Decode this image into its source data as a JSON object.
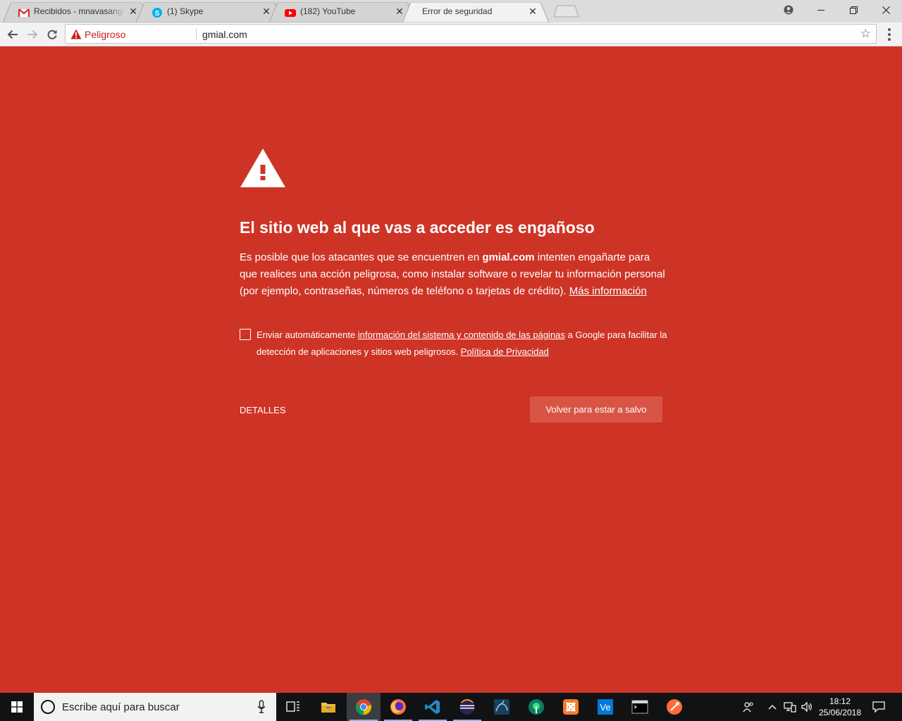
{
  "browser": {
    "tabs": [
      {
        "title": "Recibidos - mnavasangue",
        "favicon": "gmail-icon"
      },
      {
        "title": "(1) Skype",
        "favicon": "skype-icon"
      },
      {
        "title": "(182) YouTube",
        "favicon": "youtube-icon"
      },
      {
        "title": "Error de seguridad",
        "favicon": "none",
        "active": true
      }
    ],
    "omnibox": {
      "security_label": "Peligroso",
      "url": "gmial.com"
    }
  },
  "interstitial": {
    "heading": "El sitio web al que vas a acceder es engañoso",
    "description_pre": "Es posible que los atacantes que se encuentren en ",
    "description_domain": "gmial.com",
    "description_post": " intenten engañarte para que realices una acción peligrosa, como instalar software o revelar tu información personal (por ejemplo, contraseñas, números de teléfono o tarjetas de crédito). ",
    "more_info_link": "Más información",
    "optin_pre": "Enviar automáticamente ",
    "optin_link": "información del sistema y contenido de las páginas",
    "optin_mid": " a Google para facilitar la detección de aplicaciones y sitios web peligrosos. ",
    "privacy_link": "Política de Privacidad",
    "details_button": "DETALLES",
    "primary_button": "Volver para estar a salvo",
    "background_color": "#ce3426"
  },
  "taskbar": {
    "search_placeholder": "Escribe aquí para buscar",
    "apps": [
      "task-view-icon",
      "file-explorer-icon",
      "chrome-icon",
      "firefox-icon",
      "vscode-icon",
      "eclipse-icon",
      "mysql-workbench-icon",
      "android-studio-icon",
      "xampp-icon",
      "vue-icon",
      "terminal-icon",
      "postman-icon"
    ],
    "clock_time": "18:12",
    "clock_date": "25/06/2018"
  }
}
